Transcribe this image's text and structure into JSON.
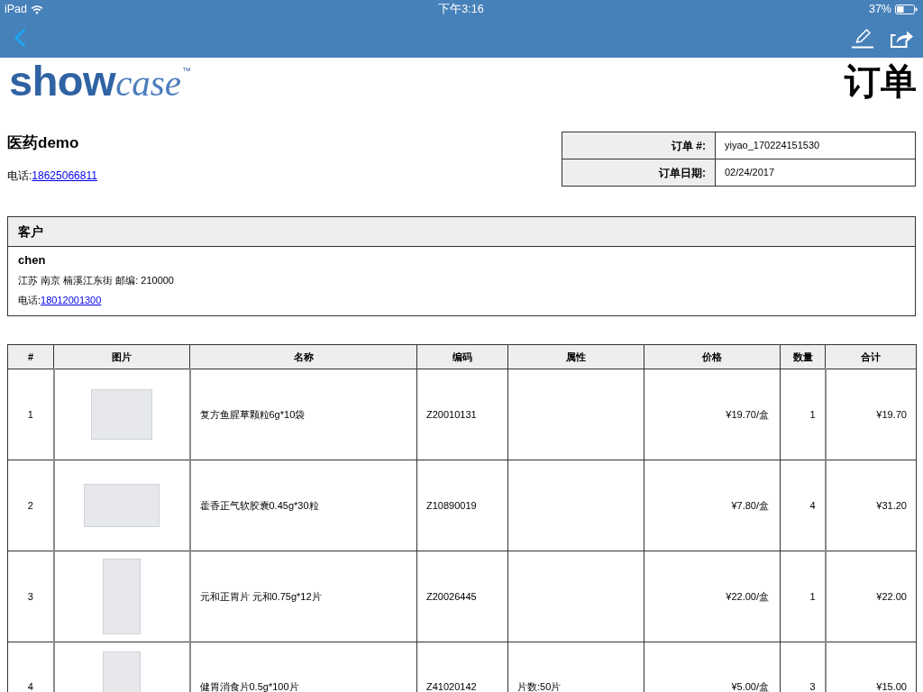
{
  "status_bar": {
    "device": "iPad",
    "time": "下午3:16",
    "battery": "37%"
  },
  "logo": {
    "bold": "show",
    "italic": "case",
    "mark": "™"
  },
  "title": "订单",
  "seller": {
    "name": "医药demo",
    "phone_label": "电话:",
    "phone": "18625066811"
  },
  "order_info": [
    {
      "label": "订单 #:",
      "value": "yiyao_170224151530"
    },
    {
      "label": "订单日期:",
      "value": "02/24/2017"
    }
  ],
  "customer": {
    "heading": "客户",
    "name": "chen",
    "address": "江苏 南京 楠溪江东街 邮编: 210000",
    "phone_label": "电话:",
    "phone": "18012001300"
  },
  "items": {
    "columns": [
      "#",
      "图片",
      "名称",
      "编码",
      "属性",
      "价格",
      "数量",
      "合计"
    ],
    "rows": [
      {
        "index": "1",
        "photo": {
          "kind": "landscape"
        },
        "name": "复方鱼腥草颗粒6g*10袋",
        "code": "Z20010131",
        "price": "¥19.70/盒",
        "quantity": "1",
        "total": "¥19.70"
      },
      {
        "index": "2",
        "photo": {
          "kind": "wide"
        },
        "name": "藿香正气软胶囊0.45g*30粒",
        "code": "Z10890019",
        "price": "¥7.80/盒",
        "quantity": "4",
        "total": "¥31.20"
      },
      {
        "index": "3",
        "photo": {
          "kind": "portrait"
        },
        "name": "元和正胃片 元和0.75g*12片",
        "code": "Z20026445",
        "price": "¥22.00/盒",
        "quantity": "1",
        "total": "¥22.00"
      },
      {
        "index": "4",
        "photo": {
          "kind": "portrait"
        },
        "name": "健胃消食片0.5g*100片",
        "code": "Z41020142",
        "attribute": "片数:50片",
        "price": "¥5.00/盒",
        "quantity": "3",
        "total": "¥15.00"
      }
    ]
  }
}
